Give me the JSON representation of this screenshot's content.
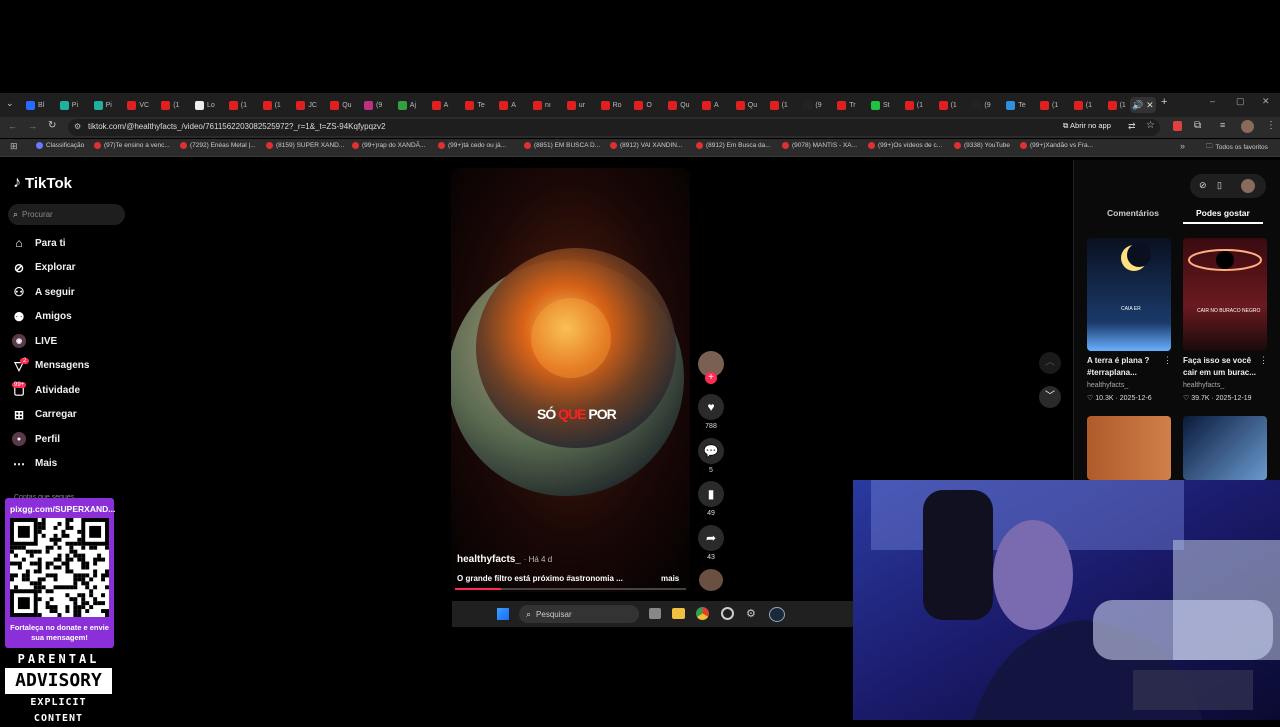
{
  "browser": {
    "tabs": [
      "Bl",
      "Pi",
      "Pi",
      "VC",
      "(1",
      "Lo",
      "(1",
      "(1",
      "JC",
      "Qu",
      "(9",
      "Aj",
      "A",
      "Te",
      "A",
      "nı",
      "ur",
      "Ro",
      "O",
      "Qu",
      "A",
      "Qu",
      "(1",
      "(9",
      "Tr",
      "St",
      "(1",
      "(1",
      "(9",
      "Te",
      "(1",
      "(1",
      "(1"
    ],
    "url": "tiktok.com/@healthyfacts_/video/7611562203082525972?_r=1&_t=ZS-94Kqfypqzv2",
    "open_in_app": "Abrir no app",
    "bookmarks": [
      "Classificação",
      "(97)Te ensino a venc...",
      "(7292) Enéas Metal |...",
      "(8159) SUPER XAND...",
      "(99+)rap do XANDÃ...",
      "(99+)tá cedo ou já...",
      "(8851) EM BUSCA D...",
      "(8912) VAI XANDIN...",
      "(8912) Em Busca da...",
      "(9078) MANTIS - XA...",
      "(99+)Os vídeos de c...",
      "(9338) YouTube",
      "(99+)Xandão vs Fra..."
    ],
    "all_bookmarks": "Todos os favoritos"
  },
  "tiktok": {
    "logo": "TikTok",
    "search_placeholder": "Procurar",
    "nav": [
      {
        "label": "Para ti",
        "icon": "home-icon"
      },
      {
        "label": "Explorar",
        "icon": "compass-icon"
      },
      {
        "label": "A seguir",
        "icon": "following-icon"
      },
      {
        "label": "Amigos",
        "icon": "friends-icon"
      },
      {
        "label": "LIVE",
        "icon": "live-icon"
      },
      {
        "label": "Mensagens",
        "icon": "messages-icon"
      },
      {
        "label": "Atividade",
        "icon": "activity-icon"
      },
      {
        "label": "Carregar",
        "icon": "upload-icon"
      },
      {
        "label": "Perfil",
        "icon": "profile-icon"
      },
      {
        "label": "Mais",
        "icon": "more-icon"
      }
    ],
    "activity_badge": "99+",
    "messages_badge": "2",
    "video": {
      "caption_overlay": [
        "SÓ",
        "QUE",
        "POR"
      ],
      "author": "healthyfacts_",
      "age": "· Há 4 d",
      "description": "O grande filtro está próximo #astronomia ...",
      "more": "mais",
      "likes": "788",
      "comments": "5",
      "saves": "49",
      "shares": "43"
    },
    "panel_tabs": [
      "Comentários",
      "Podes gostar"
    ],
    "recommended": [
      {
        "title": "A terra é plana ? #terraplana...",
        "author": "healthyfacts_",
        "likes": "10.3K",
        "date": "2025-12-6",
        "overlay": "CAIA ER"
      },
      {
        "title": "Faça isso se você cair em um burac...",
        "author": "healthyfacts_",
        "likes": "39.7K",
        "date": "2025-12-19",
        "overlay": "CAIR NO BURACO NEGRO"
      }
    ]
  },
  "overlay": {
    "pix_url": "pixgg.com/SUPERXAND...",
    "pix_text": "Fortaleça no donate e envie sua mensagem!",
    "advisory": [
      "PARENTAL",
      "ADVISORY",
      "EXPLICIT CONTENT"
    ],
    "hidden_sidebar_text": "Contas que segues"
  },
  "taskbar": {
    "search": "Pesquisar"
  }
}
